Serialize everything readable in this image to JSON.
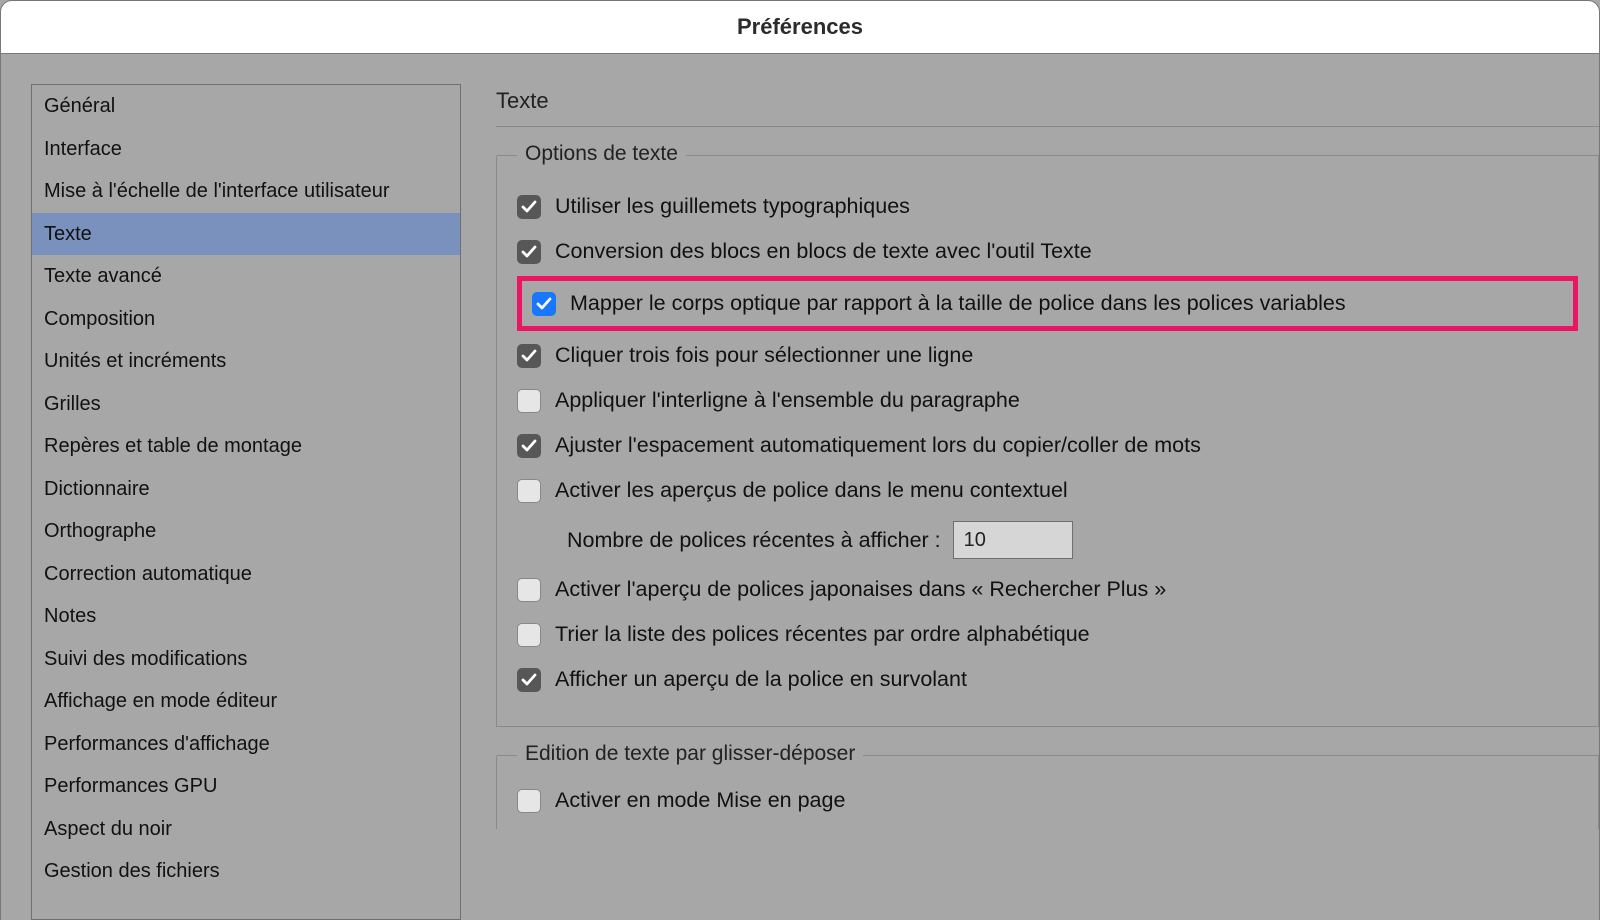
{
  "window_title": "Préférences",
  "sidebar": {
    "items": [
      {
        "label": "Général"
      },
      {
        "label": "Interface"
      },
      {
        "label": "Mise à l'échelle de l'interface utilisateur"
      },
      {
        "label": "Texte",
        "selected": true
      },
      {
        "label": "Texte avancé"
      },
      {
        "label": "Composition"
      },
      {
        "label": "Unités et incréments"
      },
      {
        "label": "Grilles"
      },
      {
        "label": "Repères et table de montage"
      },
      {
        "label": "Dictionnaire"
      },
      {
        "label": "Orthographe"
      },
      {
        "label": "Correction automatique"
      },
      {
        "label": "Notes"
      },
      {
        "label": "Suivi des modifications"
      },
      {
        "label": "Affichage en mode éditeur"
      },
      {
        "label": "Performances d'affichage"
      },
      {
        "label": "Performances GPU"
      },
      {
        "label": "Aspect du noir"
      },
      {
        "label": "Gestion des fichiers"
      }
    ]
  },
  "panel": {
    "title": "Texte",
    "group1": {
      "legend": "Options de texte",
      "opt1": {
        "label": "Utiliser les guillemets typographiques",
        "checked": true,
        "style": "grey"
      },
      "opt2": {
        "label": "Conversion des blocs en blocs de texte avec l'outil Texte",
        "checked": true,
        "style": "grey"
      },
      "opt3": {
        "label": "Mapper le corps optique par rapport à la taille de police dans les polices variables",
        "checked": true,
        "style": "blue",
        "highlighted": true
      },
      "opt4": {
        "label": "Cliquer trois fois pour sélectionner une ligne",
        "checked": true,
        "style": "grey"
      },
      "opt5": {
        "label": "Appliquer l'interligne à l'ensemble du paragraphe",
        "checked": false
      },
      "opt6": {
        "label": "Ajuster l'espacement automatiquement lors du copier/coller de mots",
        "checked": true,
        "style": "grey"
      },
      "opt7": {
        "label": "Activer les aperçus de police dans le menu contextuel",
        "checked": false
      },
      "recent_fonts": {
        "label": "Nombre de polices récentes à afficher :",
        "value": "10"
      },
      "opt8": {
        "label": "Activer l'aperçu de polices japonaises dans « Rechercher Plus »",
        "checked": false
      },
      "opt9": {
        "label": "Trier la liste des polices récentes par ordre alphabétique",
        "checked": false
      },
      "opt10": {
        "label": "Afficher un aperçu de la police en survolant",
        "checked": true,
        "style": "grey"
      }
    },
    "group2": {
      "legend": "Edition de texte par glisser-déposer",
      "opt1": {
        "label": "Activer en mode Mise en page",
        "checked": false
      }
    }
  }
}
